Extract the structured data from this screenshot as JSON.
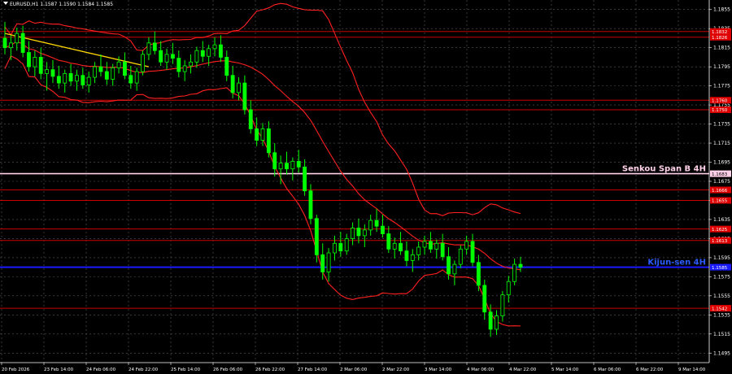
{
  "window": {
    "title": "EURUSD,H1  1.1587 1.1590 1.1584 1.1585"
  },
  "colors": {
    "background": "#000000",
    "grid": "#5a5a5a",
    "candle_up": "#00ff00",
    "candle_down": "#00ff00",
    "bollinger": "#ff2020",
    "level_red": "#c80000",
    "level_label_bg": "#e00000",
    "senkou": "#ffd0e8",
    "kijun": "#1a1aff",
    "trend": "#ffd700",
    "axis_text": "#ffffff"
  },
  "chart_data": {
    "type": "candlestick",
    "title": "EURUSD,H1",
    "ylim": [
      1.1485,
      1.1865
    ],
    "y_ticks": [
      "1.1855",
      "1.1835",
      "1.1815",
      "1.1795",
      "1.1775",
      "1.1755",
      "1.1735",
      "1.1715",
      "1.1695",
      "1.1675",
      "1.1655",
      "1.1635",
      "1.1615",
      "1.1595",
      "1.1575",
      "1.1555",
      "1.1535",
      "1.1515",
      "1.1495"
    ],
    "x_ticks": [
      "20 Feb 2026",
      "23 Feb 14:00",
      "24 Feb 06:00",
      "24 Feb 22:00",
      "25 Feb 14:00",
      "26 Feb 06:00",
      "26 Feb 22:00",
      "27 Feb 14:00",
      "2 Mar 06:00",
      "2 Mar 22:00",
      "3 Mar 14:00",
      "4 Mar 06:00",
      "4 Mar 22:00",
      "5 Mar 14:00",
      "6 Mar 06:00",
      "6 Mar 22:00",
      "9 Mar 14:00"
    ],
    "levels": [
      {
        "value": 1.1832,
        "label": "1.1832",
        "kind": "red"
      },
      {
        "value": 1.1826,
        "label": "1.1826",
        "kind": "red"
      },
      {
        "value": 1.176,
        "label": "1.1760",
        "kind": "red"
      },
      {
        "value": 1.175,
        "label": "1.1750",
        "kind": "red"
      },
      {
        "value": 1.1683,
        "label": "1.1683",
        "kind": "senkou",
        "name": "Senkou Span B 4H"
      },
      {
        "value": 1.1666,
        "label": "1.1666",
        "kind": "red"
      },
      {
        "value": 1.1655,
        "label": "1.1655",
        "kind": "red"
      },
      {
        "value": 1.1625,
        "label": "1.1625",
        "kind": "red"
      },
      {
        "value": 1.1613,
        "label": "1.1613",
        "kind": "red"
      },
      {
        "value": 1.1585,
        "label": "1.1585",
        "kind": "kijun",
        "name": "Kijun-sen 4H"
      },
      {
        "value": 1.1542,
        "label": "1.1542",
        "kind": "red"
      }
    ],
    "ohlc": [
      [
        1.1825,
        1.1842,
        1.1808,
        1.1815
      ],
      [
        1.1815,
        1.1828,
        1.1802,
        1.182
      ],
      [
        1.182,
        1.1836,
        1.1812,
        1.183
      ],
      [
        1.183,
        1.1838,
        1.1805,
        1.181
      ],
      [
        1.181,
        1.1822,
        1.179,
        1.1795
      ],
      [
        1.1795,
        1.1812,
        1.1785,
        1.1805
      ],
      [
        1.1805,
        1.1815,
        1.1782,
        1.1788
      ],
      [
        1.1788,
        1.18,
        1.177,
        1.1792
      ],
      [
        1.1792,
        1.1802,
        1.1778,
        1.1785
      ],
      [
        1.1785,
        1.1796,
        1.1772,
        1.1778
      ],
      [
        1.1778,
        1.1792,
        1.1768,
        1.1788
      ],
      [
        1.1788,
        1.1798,
        1.1775,
        1.178
      ],
      [
        1.178,
        1.1792,
        1.177,
        1.1786
      ],
      [
        1.1786,
        1.1794,
        1.1772,
        1.1776
      ],
      [
        1.1776,
        1.179,
        1.1768,
        1.1784
      ],
      [
        1.1784,
        1.18,
        1.1778,
        1.1795
      ],
      [
        1.1795,
        1.1808,
        1.1785,
        1.179
      ],
      [
        1.179,
        1.18,
        1.1776,
        1.1782
      ],
      [
        1.1782,
        1.1798,
        1.1775,
        1.1794
      ],
      [
        1.1794,
        1.1806,
        1.1788,
        1.18
      ],
      [
        1.18,
        1.181,
        1.1782,
        1.1786
      ],
      [
        1.1786,
        1.1796,
        1.1772,
        1.1778
      ],
      [
        1.1778,
        1.1794,
        1.177,
        1.179
      ],
      [
        1.179,
        1.1812,
        1.1786,
        1.1808
      ],
      [
        1.1808,
        1.1826,
        1.1802,
        1.182
      ],
      [
        1.182,
        1.1832,
        1.1808,
        1.1812
      ],
      [
        1.1812,
        1.1822,
        1.1796,
        1.18
      ],
      [
        1.18,
        1.1814,
        1.1792,
        1.1808
      ],
      [
        1.1808,
        1.182,
        1.1798,
        1.1804
      ],
      [
        1.1804,
        1.1812,
        1.1784,
        1.179
      ],
      [
        1.179,
        1.1802,
        1.178,
        1.1796
      ],
      [
        1.1796,
        1.1808,
        1.1788,
        1.18
      ],
      [
        1.18,
        1.1816,
        1.1794,
        1.1812
      ],
      [
        1.1812,
        1.1822,
        1.18,
        1.1806
      ],
      [
        1.1806,
        1.1818,
        1.1796,
        1.1814
      ],
      [
        1.1814,
        1.1826,
        1.1806,
        1.1818
      ],
      [
        1.1818,
        1.1828,
        1.18,
        1.1805
      ],
      [
        1.1805,
        1.1812,
        1.178,
        1.1786
      ],
      [
        1.1786,
        1.1796,
        1.1762,
        1.1768
      ],
      [
        1.1768,
        1.1784,
        1.176,
        1.1778
      ],
      [
        1.1778,
        1.1786,
        1.1745,
        1.175
      ],
      [
        1.175,
        1.176,
        1.1725,
        1.173
      ],
      [
        1.173,
        1.1742,
        1.1712,
        1.1718
      ],
      [
        1.1718,
        1.1736,
        1.1712,
        1.173
      ],
      [
        1.173,
        1.1738,
        1.17,
        1.1705
      ],
      [
        1.1705,
        1.1715,
        1.168,
        1.1688
      ],
      [
        1.1688,
        1.1702,
        1.1672,
        1.1694
      ],
      [
        1.1694,
        1.1706,
        1.1682,
        1.1688
      ],
      [
        1.1688,
        1.17,
        1.1676,
        1.1696
      ],
      [
        1.1696,
        1.1708,
        1.1684,
        1.169
      ],
      [
        1.169,
        1.1698,
        1.166,
        1.1665
      ],
      [
        1.1665,
        1.1672,
        1.163,
        1.1636
      ],
      [
        1.1636,
        1.164,
        1.159,
        1.1598
      ],
      [
        1.1598,
        1.161,
        1.1572,
        1.158
      ],
      [
        1.158,
        1.1605,
        1.157,
        1.16
      ],
      [
        1.16,
        1.1618,
        1.1592,
        1.161
      ],
      [
        1.161,
        1.1622,
        1.1596,
        1.1602
      ],
      [
        1.1602,
        1.162,
        1.1598,
        1.1615
      ],
      [
        1.1615,
        1.1632,
        1.1608,
        1.1626
      ],
      [
        1.1626,
        1.1636,
        1.161,
        1.1618
      ],
      [
        1.1618,
        1.163,
        1.1606,
        1.1624
      ],
      [
        1.1624,
        1.164,
        1.1618,
        1.1634
      ],
      [
        1.1634,
        1.1646,
        1.1622,
        1.1628
      ],
      [
        1.1628,
        1.164,
        1.1616,
        1.162
      ],
      [
        1.162,
        1.1628,
        1.16,
        1.1604
      ],
      [
        1.1604,
        1.1616,
        1.1594,
        1.161
      ],
      [
        1.161,
        1.1622,
        1.1598,
        1.1602
      ],
      [
        1.1602,
        1.1612,
        1.1586,
        1.1592
      ],
      [
        1.1592,
        1.1604,
        1.158,
        1.1598
      ],
      [
        1.1598,
        1.1612,
        1.1592,
        1.1606
      ],
      [
        1.1606,
        1.1618,
        1.1598,
        1.1612
      ],
      [
        1.1612,
        1.1622,
        1.16,
        1.1604
      ],
      [
        1.1604,
        1.1614,
        1.1594,
        1.161
      ],
      [
        1.161,
        1.162,
        1.1592,
        1.1596
      ],
      [
        1.1596,
        1.1606,
        1.1572,
        1.1578
      ],
      [
        1.1578,
        1.1592,
        1.1566,
        1.1588
      ],
      [
        1.1588,
        1.1608,
        1.1584,
        1.1604
      ],
      [
        1.1604,
        1.1618,
        1.1598,
        1.1612
      ],
      [
        1.1612,
        1.162,
        1.1586,
        1.159
      ],
      [
        1.159,
        1.1598,
        1.156,
        1.1566
      ],
      [
        1.1566,
        1.1572,
        1.153,
        1.1538
      ],
      [
        1.1538,
        1.1546,
        1.1512,
        1.152
      ],
      [
        1.152,
        1.154,
        1.1514,
        1.1534
      ],
      [
        1.1534,
        1.156,
        1.1528,
        1.1556
      ],
      [
        1.1556,
        1.1576,
        1.1548,
        1.157
      ],
      [
        1.157,
        1.1594,
        1.1566,
        1.1588
      ],
      [
        1.1588,
        1.1596,
        1.158,
        1.1585
      ]
    ],
    "indicators": {
      "bollinger": "upper / middle / lower bands",
      "trend_line": "descending yellow trend line"
    }
  }
}
